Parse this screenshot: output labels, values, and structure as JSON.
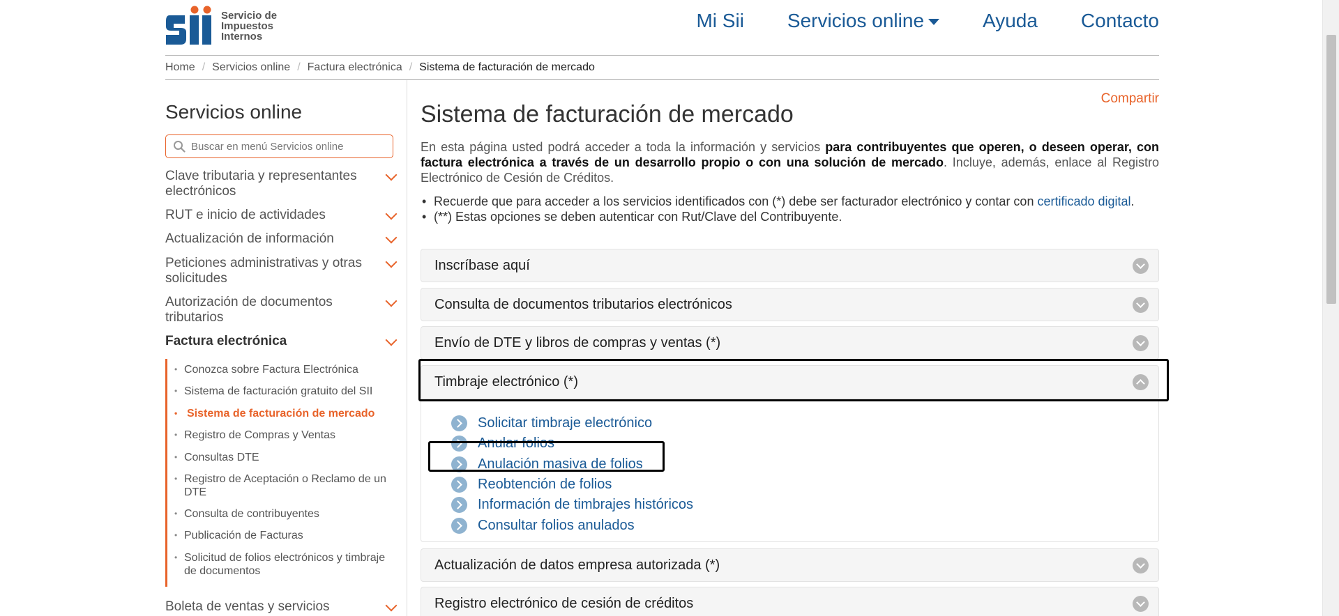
{
  "header": {
    "logo": {
      "mark": "Sii",
      "line1": "Servicio de",
      "line2": "Impuestos",
      "line3": "Internos"
    },
    "nav": [
      {
        "label": "Mi Sii"
      },
      {
        "label": "Servicios online"
      },
      {
        "label": "Ayuda"
      },
      {
        "label": "Contacto"
      }
    ]
  },
  "breadcrumb": [
    "Home",
    "Servicios online",
    "Factura electrónica",
    "Sistema de facturación de mercado"
  ],
  "sidebar": {
    "title": "Servicios online",
    "search_placeholder": "Buscar en menú Servicios online",
    "items": [
      "Clave tributaria y representantes electrónicos",
      "RUT e inicio de actividades",
      "Actualización de información",
      "Peticiones administrativas y otras solicitudes",
      "Autorización de documentos tributarios",
      "Factura electrónica"
    ],
    "subitems": [
      "Conozca sobre Factura Electrónica",
      "Sistema de facturación gratuito del SII",
      "Sistema de facturación de mercado",
      "Registro de Compras y Ventas",
      "Consultas DTE",
      "Registro de Aceptación o Reclamo de un DTE",
      "Consulta de contribuyentes",
      "Publicación de Facturas",
      "Solicitud de folios electrónicos y timbraje de documentos"
    ],
    "next_item": "Boleta de ventas y servicios"
  },
  "main": {
    "share": "Compartir",
    "title": "Sistema de facturación de mercado",
    "intro_1": "En esta página usted podrá acceder a toda la información y servicios ",
    "intro_bold": "para contribuyentes que operen, o deseen operar, con factura electrónica a través de un desarrollo propio o con una solución de mercado",
    "intro_2": ". Incluye, además, enlace al Registro Electrónico de Cesión de Créditos.",
    "bullet1_text": "Recuerde que para acceder a los servicios identificados con (*) debe ser facturador electrónico y contar con ",
    "bullet1_link": "certificado digital",
    "bullet1_end": ".",
    "bullet2": "(**) Estas opciones se deben autenticar con Rut/Clave del Contribuyente.",
    "accordions": [
      "Inscríbase aquí",
      "Consulta de documentos tributarios electrónicos",
      "Envío de DTE y libros de compras y ventas (*)",
      "Timbraje electrónico (*)",
      "Actualización de datos empresa autorizada (*)",
      "Registro electrónico de cesión de créditos"
    ],
    "timbraje_links": [
      "Solicitar timbraje electrónico",
      "Anular folios",
      "Anulación masiva de folios",
      "Reobtención de folios",
      "Información de timbrajes históricos",
      "Consultar folios anulados"
    ]
  },
  "colors": {
    "accent": "#e8632a",
    "link": "#1a5a96"
  }
}
